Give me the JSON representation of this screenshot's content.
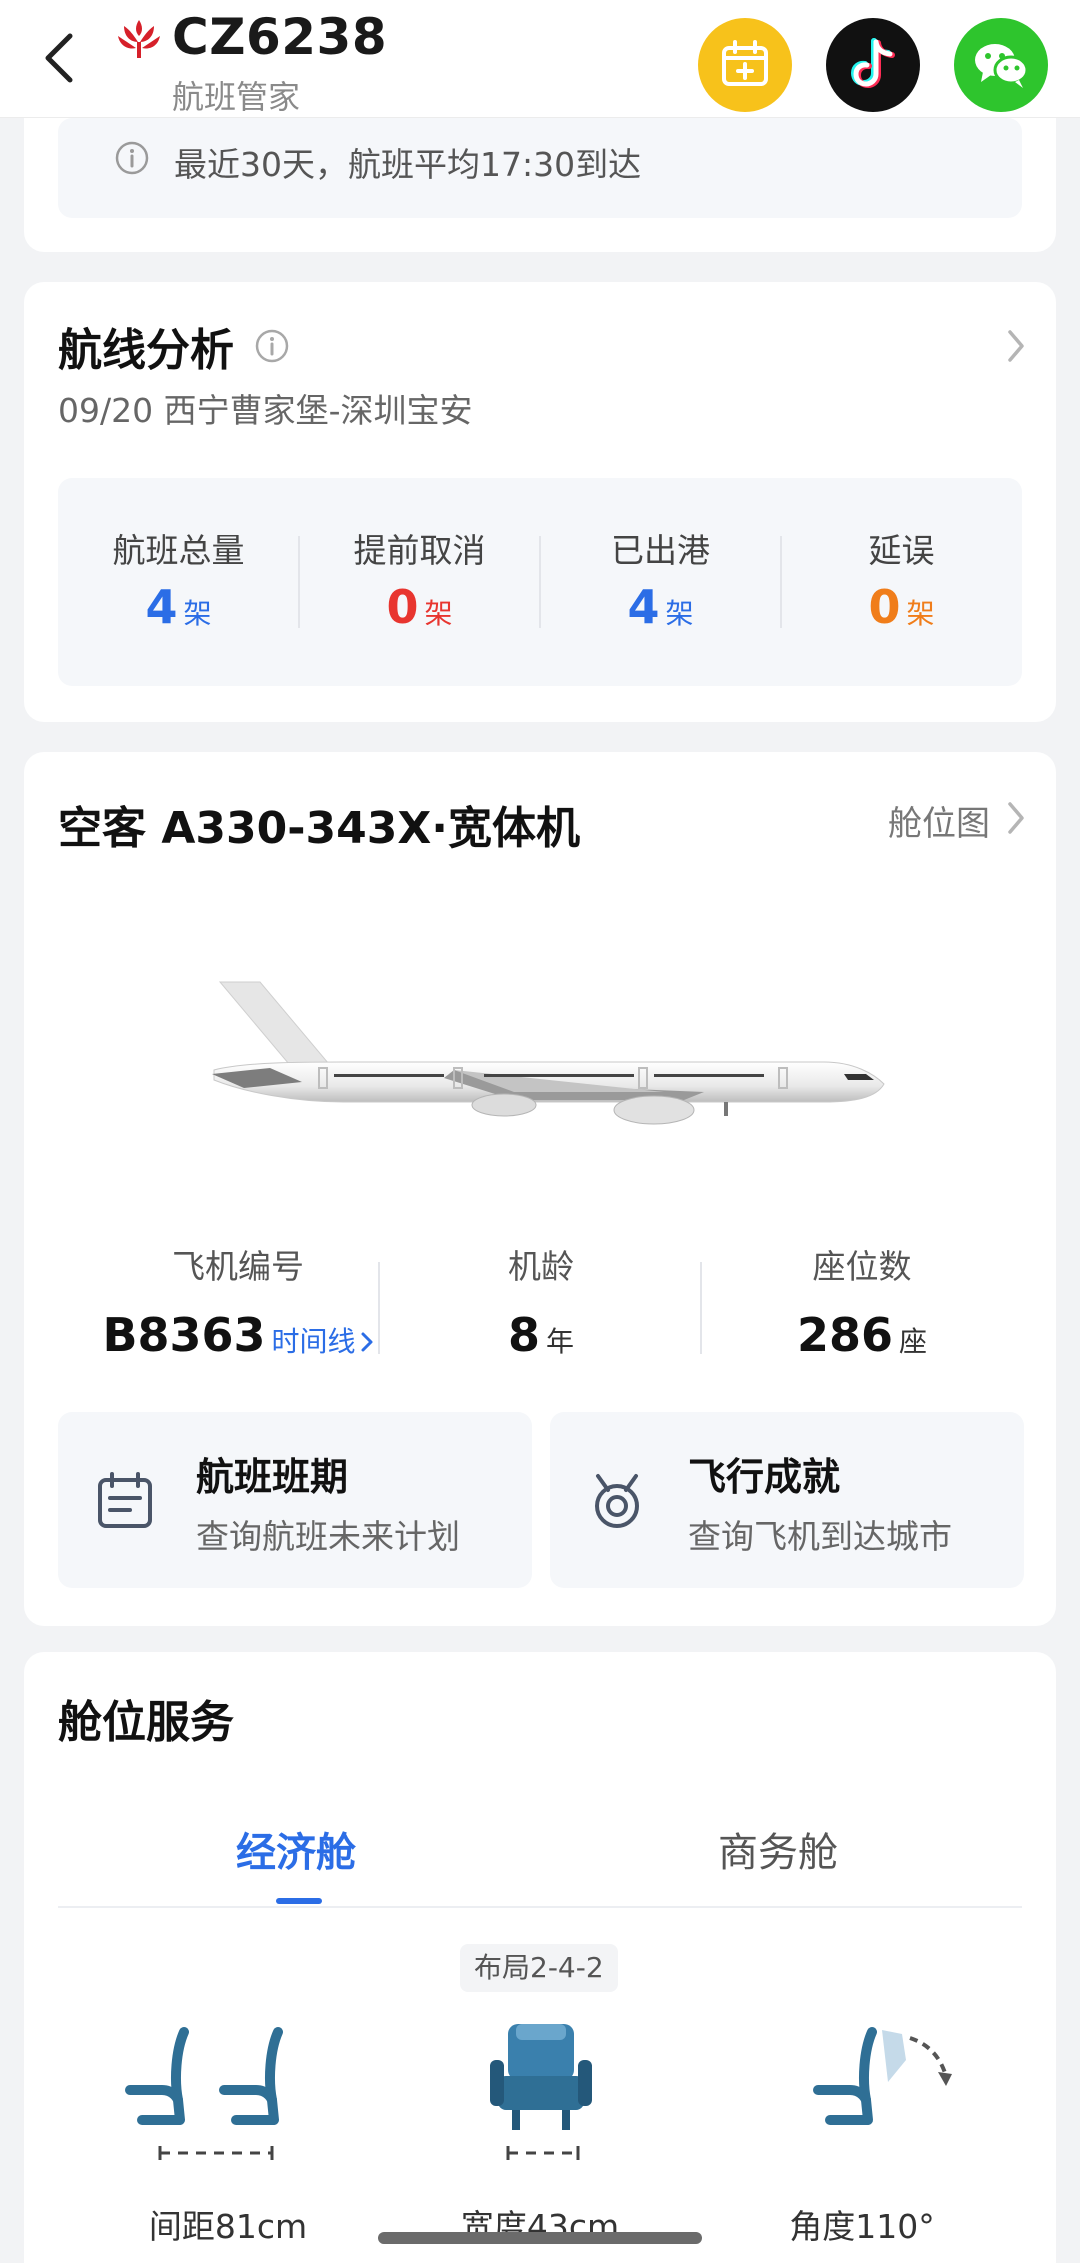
{
  "header": {
    "flight_number": "CZ6238",
    "app_name": "航班管家",
    "icons": [
      "back-icon",
      "airline-logo",
      "calendar-add-icon",
      "tiktok-icon",
      "wechat-icon"
    ]
  },
  "notice": {
    "text": "最近30天，航班平均17:30到达"
  },
  "route_analysis": {
    "title": "航线分析",
    "subtitle": "09/20 西宁曹家堡-深圳宝安",
    "stats": [
      {
        "label": "航班总量",
        "value": "4",
        "unit": "架",
        "color": "#2b6de6"
      },
      {
        "label": "提前取消",
        "value": "0",
        "unit": "架",
        "color": "#e8352f"
      },
      {
        "label": "已出港",
        "value": "4",
        "unit": "架",
        "color": "#2b6de6"
      },
      {
        "label": "延误",
        "value": "0",
        "unit": "架",
        "color": "#f07d1a"
      }
    ]
  },
  "aircraft": {
    "title": "空客 A330-343X·宽体机",
    "seat_map_link": "舱位图",
    "registration_label": "飞机编号",
    "registration": "B8363",
    "timeline_link": "时间线",
    "age_label": "机龄",
    "age": "8",
    "age_unit": "年",
    "seats_label": "座位数",
    "seats": "286",
    "seats_unit": "座",
    "tiles": [
      {
        "title": "航班班期",
        "subtitle": "查询航班未来计划",
        "icon": "schedule-icon"
      },
      {
        "title": "飞行成就",
        "subtitle": "查询飞机到达城市",
        "icon": "medal-icon"
      }
    ]
  },
  "cabin_service": {
    "title": "舱位服务",
    "tabs": [
      "经济舱",
      "商务舱"
    ],
    "active_tab": "经济舱",
    "layout": "布局2-4-2",
    "features": [
      {
        "caption": "间距81cm",
        "icon": "seat-pitch-icon"
      },
      {
        "caption": "宽度43cm",
        "icon": "seat-width-icon"
      },
      {
        "caption": "角度110°",
        "icon": "seat-recline-icon"
      }
    ]
  },
  "colors": {
    "accent_blue": "#2b6de6",
    "danger_red": "#e8352f",
    "warning_orange": "#f07d1a",
    "seat_blue": "#2f6f95"
  }
}
